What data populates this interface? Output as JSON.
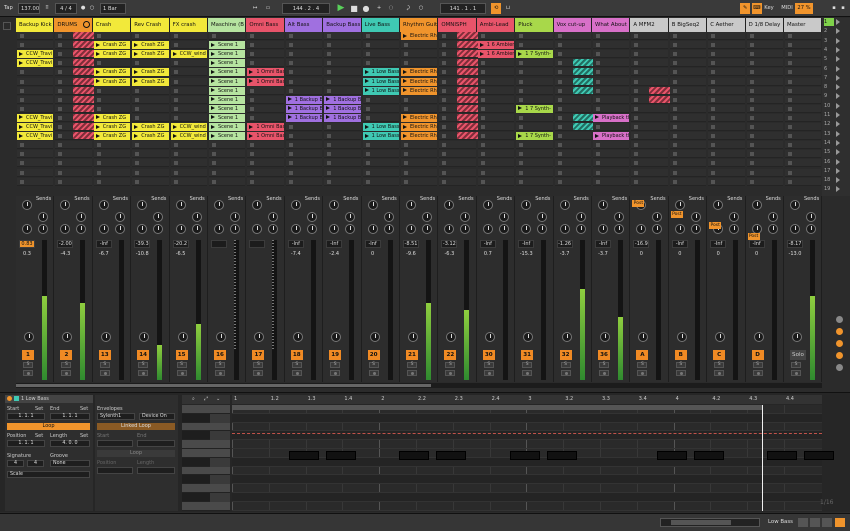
{
  "transport": {
    "tap": "Tap",
    "tempo": "137.00",
    "signature": "4 / 4",
    "quantize": "1 Bar",
    "position": "144 .  2 .  4",
    "loop_start": "141 .  1 .  1",
    "key": "Key",
    "midi": "MIDI",
    "cpu": "27 %"
  },
  "tracks": [
    {
      "name": "Backup Kick",
      "color": "#f2e93a"
    },
    {
      "name": "DRUMS",
      "color": "#f0942c"
    },
    {
      "name": "Crash",
      "color": "#f2e93a"
    },
    {
      "name": "Rev Crash",
      "color": "#f2e93a"
    },
    {
      "name": "FX crash",
      "color": "#f2e93a"
    },
    {
      "name": "Maschine (B",
      "color": "#b6e4a0"
    },
    {
      "name": "Omni Bass",
      "color": "#e8546a"
    },
    {
      "name": "Alt Bass",
      "color": "#a070e0"
    },
    {
      "name": "Backup Bass",
      "color": "#a070e0"
    },
    {
      "name": "Live Bass",
      "color": "#3fc9b3"
    },
    {
      "name": "Rhythm Guit",
      "color": "#f0942c"
    },
    {
      "name": "OMNISPH",
      "color": "#e8546a"
    },
    {
      "name": "Ambi-Lead",
      "color": "#e8546a"
    },
    {
      "name": "Pluck",
      "color": "#a8d84a"
    },
    {
      "name": "Vox cut-up",
      "color": "#d870c8"
    },
    {
      "name": "What About",
      "color": "#d870c8"
    },
    {
      "name": "A MFM2",
      "color": "#c9c9c9"
    },
    {
      "name": "B BigSeq2",
      "color": "#c9c9c9"
    },
    {
      "name": "C Aether",
      "color": "#c9c9c9"
    },
    {
      "name": "D 1/8 Delay",
      "color": "#c9c9c9"
    },
    {
      "name": "Master",
      "color": "#c9c9c9"
    }
  ],
  "clip_labels": {
    "kick": "CCW_Travi",
    "crash": "Crash ZG",
    "fx": "CCW_wind",
    "scene": "Scene 1",
    "omni": "1 Omni Bas",
    "alt": "1 Backup B",
    "live": "1 Low Bass",
    "rhythm": "Electric Rh",
    "ambi": "1 6 Ambien",
    "pluck": "1 7 Synth-",
    "vox": "Playback th"
  },
  "mixer": {
    "sends_label": "Sends",
    "volumes": [
      "0.83",
      "-2.00",
      "-Inf",
      "-39.3",
      "-20.2",
      "",
      "",
      "-Inf",
      "-Inf",
      "-Inf",
      "-8.51",
      "-3.12",
      "-Inf",
      "-Inf",
      "-1.26",
      "-Inf",
      "-16.9",
      "-Inf",
      "-Inf",
      "-Inf",
      "-8.17"
    ],
    "peaks": [
      "0.3",
      "-4.3",
      "-6.7",
      "-10.8",
      "-6.5",
      "",
      "",
      "-7.4",
      "-2.4",
      "0",
      "-9.6",
      "-6.3",
      "0.7",
      "-15.3",
      "-3.7",
      "-3.7",
      "0",
      "0",
      "0",
      "0",
      "-13.0"
    ],
    "numbers": [
      "1",
      "2",
      "13",
      "14",
      "15",
      "16",
      "17",
      "18",
      "19",
      "20",
      "21",
      "22",
      "30",
      "31",
      "32",
      "36",
      "A",
      "B",
      "C",
      "D",
      ""
    ],
    "meter_levels": [
      0.6,
      0.55,
      0,
      0.25,
      0.4,
      0,
      0,
      0,
      0,
      0,
      0.55,
      0.5,
      0,
      0,
      0.65,
      0.45,
      0,
      0,
      0,
      0,
      0.6
    ],
    "post_label": "Post",
    "solo_label": "S",
    "master_solo": "Solo"
  },
  "clip_view": {
    "clip_name": "1 Low Bass",
    "start_label": "Start",
    "set_label": "Set",
    "end_label": "End",
    "start_val": "1.  1.  1",
    "end_val": "1.  1.  1",
    "loop_label": "Loop",
    "position_label": "Position",
    "length_label": "Length",
    "position_val": "1.  1.  1",
    "length_val": "4.  0.  0",
    "signature_label": "Signature",
    "groove_label": "Groove",
    "sig_num": "4",
    "sig_den": "4",
    "groove_val": "None",
    "scale_label": "Scale",
    "envelopes_label": "Envelopes",
    "env_device": "Sylenth1",
    "env_param": "Device On",
    "linked_loop": "Linked Loop",
    "env_start": "Start",
    "env_end": "End",
    "env_loop": "Loop",
    "env_position": "Position",
    "env_length": "Length",
    "ruler": [
      "1",
      "1.2",
      "1.3",
      "1.4",
      "2",
      "2.2",
      "2.3",
      "2.4",
      "3",
      "3.2",
      "3.3",
      "3.4",
      "4",
      "4.2",
      "4.3",
      "4.4"
    ],
    "page": "1/16"
  },
  "status": {
    "track_name": "Low Bass"
  }
}
